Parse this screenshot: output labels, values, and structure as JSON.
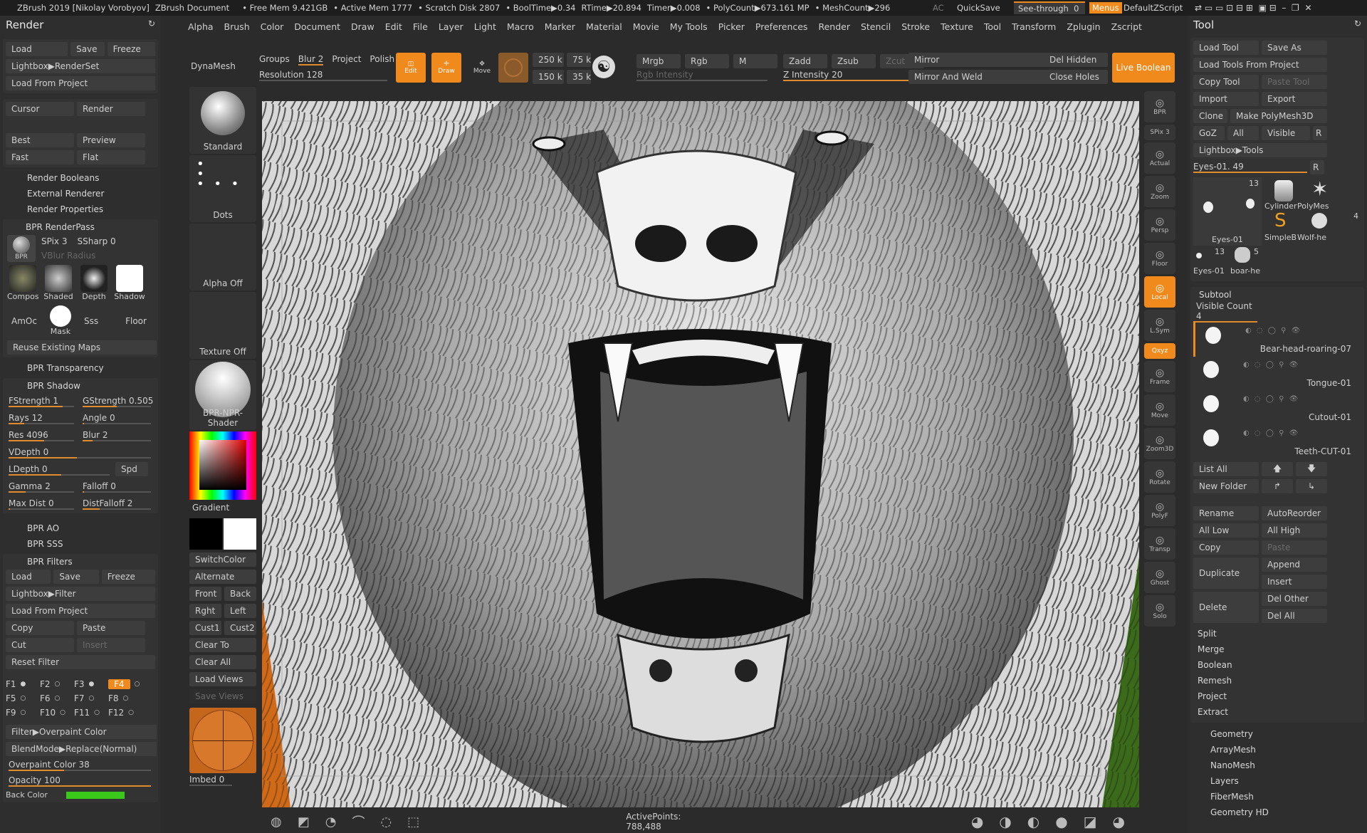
{
  "titlebar": {
    "app": "ZBrush 2019 [Nikolay Vorobyov]",
    "doc": "ZBrush Document",
    "free_mem": "• Free Mem 9.421GB",
    "active_mem": "• Active Mem 1777",
    "scratch": "• Scratch Disk 2807",
    "booltime": "• BoolTime▶0.34",
    "rtime": "RTime▶20.894",
    "timer": "Timer▶0.008",
    "polycount": "• PolyCount▶673.161 MP",
    "meshcount": "• MeshCount▶296",
    "ac": "AC",
    "quicksave": "QuickSave",
    "seethrough": "See-through",
    "seethrough_val": "0",
    "menus": "Menus",
    "script": "DefaultZScript"
  },
  "menubar": [
    "Alpha",
    "Brush",
    "Color",
    "Document",
    "Draw",
    "Edit",
    "File",
    "Layer",
    "Light",
    "Macro",
    "Marker",
    "Material",
    "Movie",
    "My Tools",
    "Picker",
    "Preferences",
    "Render",
    "Stencil",
    "Stroke",
    "Texture",
    "Tool",
    "Transform",
    "Zplugin",
    "Zscript"
  ],
  "render": {
    "title": "Render",
    "load": "Load",
    "save": "Save",
    "freeze": "Freeze",
    "lightbox": "Lightbox▶RenderSet",
    "load_project": "Load From Project",
    "cursor": "Cursor",
    "render": "Render",
    "best": "Best",
    "preview": "Preview",
    "fast": "Fast",
    "flat": "Flat",
    "booleans": "Render Booleans",
    "external": "External Renderer",
    "properties": "Render Properties",
    "renderpass": "BPR RenderPass",
    "spix": "SPix 3",
    "ssharp": "SSharp 0",
    "vblur": "VBlur Radius",
    "passes": [
      "Compos",
      "Shaded",
      "Depth",
      "Shadow"
    ],
    "amoc": "AmOc",
    "mask": "Mask",
    "sss": "Sss",
    "floor": "Floor",
    "reuse": "Reuse Existing Maps",
    "transparency": "BPR Transparency",
    "shadow": "BPR Shadow",
    "fstrength": "FStrength 1",
    "gstrength": "GStrength 0.505",
    "rays": "Rays 12",
    "angle": "Angle 0",
    "res": "Res 4096",
    "blur": "Blur 2",
    "vdepth": "VDepth 0",
    "ldepth": "LDepth 0",
    "spd": "Spd",
    "gamma": "Gamma 2",
    "falloff": "Falloff 0",
    "maxdist": "Max Dist 0",
    "distfalloff": "DistFalloff 2",
    "ao": "BPR AO",
    "sss_h": "BPR SSS",
    "filters": "BPR Filters",
    "f_load": "Load",
    "f_save": "Save",
    "f_freeze": "Freeze",
    "f_lightbox": "Lightbox▶Filter",
    "f_project": "Load From Project",
    "copy": "Copy",
    "paste": "Paste",
    "cut": "Cut",
    "insert": "Insert",
    "reset": "Reset Filter",
    "fkeys": [
      "F1",
      "F2",
      "F3",
      "F4",
      "F5",
      "F6",
      "F7",
      "F8",
      "F9",
      "F10",
      "F11",
      "F12"
    ],
    "filter_mode": "Filter▶Overpaint Color",
    "blend": "BlendMode▶Replace(Normal)",
    "overpaint": "Overpaint Color 38",
    "opacity": "Opacity 100",
    "backcolor": "Back Color"
  },
  "shelf": {
    "dynamesh": "DynaMesh",
    "brush": "Standard",
    "stroke": "Dots",
    "alpha": "Alpha Off",
    "texture": "Texture Off",
    "material": "BPR-NPR-Shader",
    "gradient": "Gradient",
    "switchcolor": "SwitchColor",
    "alternate": "Alternate",
    "front": "Front",
    "back": "Back",
    "rght": "Rght",
    "left": "Left",
    "cust1": "Cust1",
    "cust2": "Cust2",
    "clearto": "Clear To",
    "clearall": "Clear All",
    "loadviews": "Load Views",
    "saveviews": "Save Views",
    "imbed": "Imbed 0"
  },
  "toolbar": {
    "groups": "Groups",
    "blur": "Blur 2",
    "project": "Project",
    "polish": "Polish",
    "resolution": "Resolution 128",
    "edit": "Edit",
    "draw": "Draw",
    "move": "Move",
    "v250": "250 k",
    "v75": "75 k",
    "v150": "150 k",
    "v35": "35 k",
    "mrgb": "Mrgb",
    "rgb": "Rgb",
    "m": "M",
    "rgb_intensity": "Rgb Intensity",
    "zadd": "Zadd",
    "zsub": "Zsub",
    "zcut": "Zcut",
    "zintensity": "Z Intensity 20",
    "mirror": "Mirror",
    "mirror_weld": "Mirror And Weld",
    "del_hidden": "Del Hidden",
    "close_holes": "Close Holes",
    "live_boolean": "Live Boolean"
  },
  "righttools": [
    {
      "label": "BPR",
      "on": false
    },
    {
      "label": "SPix 3",
      "on": false
    },
    {
      "label": "Actual",
      "on": false
    },
    {
      "label": "Zoom",
      "on": false
    },
    {
      "label": "Persp",
      "on": false
    },
    {
      "label": "Floor",
      "on": false
    },
    {
      "label": "Local",
      "on": true
    },
    {
      "label": "L.Sym",
      "on": false
    },
    {
      "label": "Qxyz",
      "on": true
    },
    {
      "label": "Frame",
      "on": false
    },
    {
      "label": "Move",
      "on": false
    },
    {
      "label": "Zoom3D",
      "on": false
    },
    {
      "label": "Rotate",
      "on": false
    },
    {
      "label": "PolyF",
      "on": false
    },
    {
      "label": "Transp",
      "on": false
    },
    {
      "label": "Ghost",
      "on": false
    },
    {
      "label": "Solo",
      "on": false
    }
  ],
  "tool": {
    "title": "Tool",
    "load": "Load Tool",
    "saveas": "Save As",
    "load_project": "Load Tools From Project",
    "copy": "Copy Tool",
    "paste": "Paste Tool",
    "import": "Import",
    "export": "Export",
    "clone": "Clone",
    "make_poly": "Make PolyMesh3D",
    "goz": "GoZ",
    "all": "All",
    "visible": "Visible",
    "r": "R",
    "lightbox": "Lightbox▶Tools",
    "current": "Eyes-01. 49",
    "thumbs": [
      "Eyes-01",
      "Cylinder",
      "PolyMes",
      "SimpleB",
      "Wolf-he",
      "Eyes-01",
      "boar-he"
    ],
    "thumb_count1": "13",
    "thumb_count2": "13",
    "thumb_count3": "4",
    "thumb_count4": "5",
    "subtool": "Subtool",
    "visible_count": "Visible Count 4",
    "subtools": [
      "Bear-head-roaring-07",
      "Tongue-01",
      "Cutout-01",
      "Teeth-CUT-01"
    ],
    "listall": "List All",
    "newfolder": "New Folder",
    "rename": "Rename",
    "autoreorder": "AutoReorder",
    "alllow": "All Low",
    "allhigh": "All High",
    "copy2": "Copy",
    "paste2": "Paste",
    "duplicate": "Duplicate",
    "append": "Append",
    "insert": "Insert",
    "delete": "Delete",
    "delother": "Del Other",
    "delall": "Del All",
    "split": "Split",
    "merge": "Merge",
    "boolean": "Boolean",
    "remesh": "Remesh",
    "project": "Project",
    "extract": "Extract",
    "geometry": "Geometry",
    "arraymesh": "ArrayMesh",
    "nanomesh": "NanoMesh",
    "layers": "Layers",
    "fibermesh": "FiberMesh",
    "geometryhd": "Geometry HD"
  },
  "status": {
    "active_points": "ActivePoints: 788,488"
  }
}
